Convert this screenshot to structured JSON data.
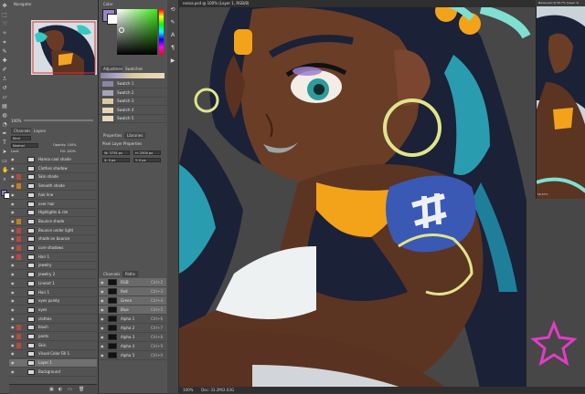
{
  "document_tab": "nessa.psd @ 100% (Layer 1, RGB/8)",
  "ref_window_title": "Nessa.psd @ 56.7% (Layer 1)",
  "status": {
    "zoom": "100%",
    "doc": "Doc: 33.2M/2.03G",
    "ref_zoom": "56.67%"
  },
  "navigator": {
    "tabs": [
      "Navigator"
    ],
    "zoom": "100%"
  },
  "color": {
    "tab": "Color",
    "accent": "#3f8d2a"
  },
  "swatches_panel": {
    "tabs": [
      "Adjustments",
      "Swatches"
    ],
    "items": [
      {
        "label": "Swatch 1",
        "color": "#8a84a8"
      },
      {
        "label": "Swatch 2",
        "color": "#a7a4b6"
      },
      {
        "label": "Swatch 3",
        "color": "#d8cba0"
      },
      {
        "label": "Swatch 4",
        "color": "#e8d6b0"
      },
      {
        "label": "Swatch 5",
        "color": "#ead8b9"
      }
    ]
  },
  "properties": {
    "tabs": [
      "Properties",
      "Libraries"
    ],
    "title": "Pixel Layer Properties",
    "w": "W: 3735 px",
    "h": "H: 2500 px",
    "x": "X: 0 px",
    "y": "Y: 0 px"
  },
  "layers_panel": {
    "tabs": [
      "Channels",
      "Layers"
    ],
    "kind": "Kind",
    "mode": "Normal",
    "opacity": "Opacity: 100%",
    "lock": "Lock:",
    "fill": "Fill: 100%",
    "rows": [
      {
        "name": "Hanna cool shade",
        "mark": "none"
      },
      {
        "name": "Clothes shadow",
        "mark": "none"
      },
      {
        "name": "Skin shade",
        "mark": "red"
      },
      {
        "name": "Smooth shade",
        "mark": "org"
      },
      {
        "name": "hair line",
        "mark": "none"
      },
      {
        "name": "over hair",
        "mark": "none"
      },
      {
        "name": "Highlights & rim",
        "mark": "none"
      },
      {
        "name": "Bounce shade",
        "mark": "org"
      },
      {
        "name": "Bounce under light",
        "mark": "red"
      },
      {
        "name": "shade on bounce",
        "mark": "red"
      },
      {
        "name": "core shadows",
        "mark": "red"
      },
      {
        "name": "Hair 1",
        "mark": "red"
      },
      {
        "name": "jewelry",
        "mark": "none"
      },
      {
        "name": "jewelry 2",
        "mark": "none"
      },
      {
        "name": "Lineart 1",
        "mark": "none"
      },
      {
        "name": "Hair 1",
        "mark": "none"
      },
      {
        "name": "eyes pointy",
        "mark": "none"
      },
      {
        "name": "eyes",
        "mark": "none"
      },
      {
        "name": "clothes",
        "mark": "none"
      },
      {
        "name": "blush",
        "mark": "red"
      },
      {
        "name": "pants",
        "mark": "red"
      },
      {
        "name": "Skin",
        "mark": "red"
      },
      {
        "name": "Visual Color Fill 1",
        "mark": "none"
      },
      {
        "name": "Layer 1",
        "mark": "none"
      },
      {
        "name": "Background",
        "mark": "none"
      }
    ]
  },
  "channels_panel": {
    "tabs": [
      "Channels",
      "Paths"
    ],
    "rows": [
      {
        "name": "RGB",
        "shortcut": "Ctrl+2"
      },
      {
        "name": "Red",
        "shortcut": "Ctrl+3"
      },
      {
        "name": "Green",
        "shortcut": "Ctrl+4"
      },
      {
        "name": "Blue",
        "shortcut": "Ctrl+5"
      },
      {
        "name": "Alpha 1",
        "shortcut": "Ctrl+6"
      },
      {
        "name": "Alpha 2",
        "shortcut": "Ctrl+7"
      },
      {
        "name": "Alpha 3",
        "shortcut": "Ctrl+8"
      },
      {
        "name": "Alpha 4",
        "shortcut": "Ctrl+9"
      },
      {
        "name": "Alpha 5",
        "shortcut": "Ctrl+0"
      }
    ]
  }
}
